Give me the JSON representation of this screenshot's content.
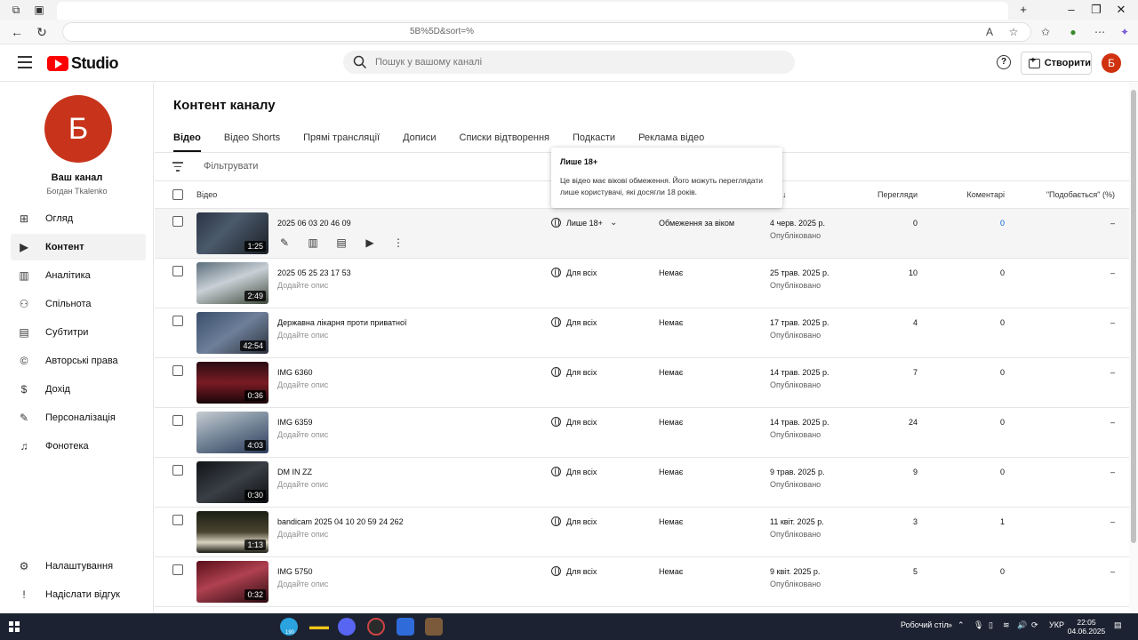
{
  "header": {
    "logo_text": "Studio",
    "search_placeholder": "Пошук у вашому каналі",
    "create_label": "Створити",
    "avatar_letter": "Б"
  },
  "browser": {
    "url_fragment": "5B%5D&sort=%"
  },
  "sidebar": {
    "avatar_letter": "Б",
    "channel_name": "Ваш канал",
    "channel_owner": "Богдан Tkalenko",
    "items": [
      {
        "label": "Огляд",
        "icon": "dashboard-icon"
      },
      {
        "label": "Контент",
        "icon": "content-icon"
      },
      {
        "label": "Аналітика",
        "icon": "analytics-icon"
      },
      {
        "label": "Спільнота",
        "icon": "community-icon"
      },
      {
        "label": "Субтитри",
        "icon": "subtitles-icon"
      },
      {
        "label": "Авторські права",
        "icon": "copyright-icon"
      },
      {
        "label": "Дохід",
        "icon": "earn-icon"
      },
      {
        "label": "Персоналізація",
        "icon": "customization-icon"
      },
      {
        "label": "Фонотека",
        "icon": "audio-library-icon"
      }
    ],
    "bottom_items": [
      {
        "label": "Налаштування",
        "icon": "settings-icon"
      },
      {
        "label": "Надіслати відгук",
        "icon": "feedback-icon"
      }
    ]
  },
  "main": {
    "title": "Контент каналу",
    "tabs": [
      "Відео",
      "Відео Shorts",
      "Прямі трансляції",
      "Дописи",
      "Списки відтворення",
      "Подкасти",
      "Реклама відео"
    ],
    "filter_label": "Фільтрувати",
    "columns": {
      "video": "Відео",
      "views": "Перегляди",
      "comments": "Коментарі",
      "likes": "\"Подобається\" (%)"
    },
    "rows": [
      {
        "title": "2025 06 03 20 46 09",
        "desc": "",
        "duration": "1:25",
        "visibility": "Лише 18+",
        "restrictions": "Обмеження за віком",
        "date": "4 черв. 2025 р.",
        "status": "Опубліковано",
        "views": "0",
        "comments": "0",
        "likes": "–"
      },
      {
        "title": "2025 05 25 23 17 53",
        "desc": "Додайте опис",
        "duration": "2:49",
        "visibility": "Для всіх",
        "restrictions": "Немає",
        "date": "25 трав. 2025 р.",
        "status": "Опубліковано",
        "views": "10",
        "comments": "0",
        "likes": "–"
      },
      {
        "title": "Державна лікарня проти приватної",
        "desc": "Додайте опис",
        "duration": "42:54",
        "visibility": "Для всіх",
        "restrictions": "Немає",
        "date": "17 трав. 2025 р.",
        "status": "Опубліковано",
        "views": "4",
        "comments": "0",
        "likes": "–"
      },
      {
        "title": "IMG 6360",
        "desc": "Додайте опис",
        "duration": "0:36",
        "visibility": "Для всіх",
        "restrictions": "Немає",
        "date": "14 трав. 2025 р.",
        "status": "Опубліковано",
        "views": "7",
        "comments": "0",
        "likes": "–"
      },
      {
        "title": "IMG 6359",
        "desc": "Додайте опис",
        "duration": "4:03",
        "visibility": "Для всіх",
        "restrictions": "Немає",
        "date": "14 трав. 2025 р.",
        "status": "Опубліковано",
        "views": "24",
        "comments": "0",
        "likes": "–"
      },
      {
        "title": "DM IN ZZ",
        "desc": "Додайте опис",
        "duration": "0:30",
        "visibility": "Для всіх",
        "restrictions": "Немає",
        "date": "9 трав. 2025 р.",
        "status": "Опубліковано",
        "views": "9",
        "comments": "0",
        "likes": "–"
      },
      {
        "title": "bandicam 2025 04 10 20 59 24 262",
        "desc": "Додайте опис",
        "duration": "1:13",
        "visibility": "Для всіх",
        "restrictions": "Немає",
        "date": "11 квіт. 2025 р.",
        "status": "Опубліковано",
        "views": "3",
        "comments": "1",
        "likes": "–"
      },
      {
        "title": "IMG 5750",
        "desc": "Додайте опис",
        "duration": "0:32",
        "visibility": "Для всіх",
        "restrictions": "Немає",
        "date": "9 квіт. 2025 р.",
        "status": "Опубліковано",
        "views": "5",
        "comments": "0",
        "likes": "–"
      }
    ]
  },
  "tooltip": {
    "title": "Лише 18+",
    "body": "Це відео має вікові обмеження. Його можуть переглядати лише користувачі, які досягли 18 років."
  },
  "taskbar": {
    "desktop_label": "Робочий стіл",
    "lang": "УКР",
    "time": "22:05",
    "date": "04.06.2025",
    "telegram_badge": "190"
  },
  "colors": {
    "brand_red": "#ff0000",
    "link_blue": "#065fd4",
    "avatar": "#c8341b"
  }
}
